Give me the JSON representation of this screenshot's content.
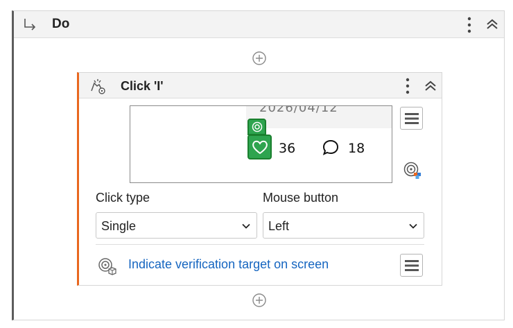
{
  "do_block": {
    "title": "Do",
    "enter_icon": "enter-arrow-icon",
    "menu_icon": "kebab-menu-icon",
    "collapse_icon": "chevron-up-double-icon",
    "add_icon": "plus-circle-icon"
  },
  "click_activity": {
    "title": "Click 'I'",
    "activity_icon": "click-cursor-icon",
    "accent_color": "#e9671f",
    "preview": {
      "date_text": "2026/04/12",
      "like_count": "36",
      "comment_count": "18",
      "target_color": "#2ea44f"
    },
    "click_type": {
      "label": "Click type",
      "value": "Single"
    },
    "mouse_button": {
      "label": "Mouse button",
      "value": "Left"
    },
    "verification_link": "Indicate verification target on screen"
  }
}
